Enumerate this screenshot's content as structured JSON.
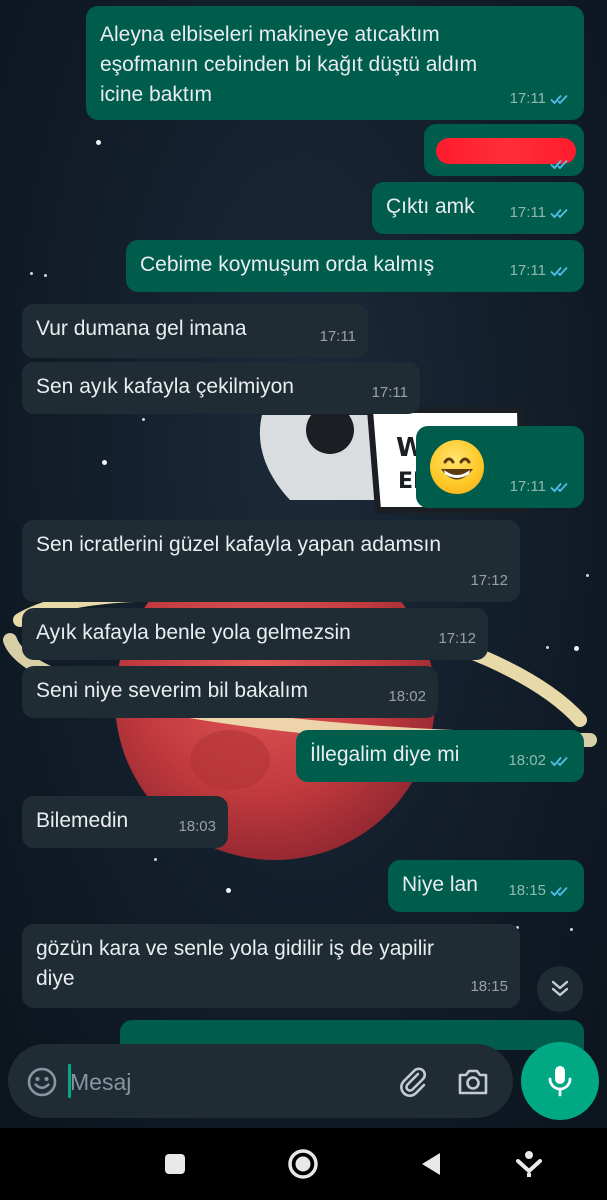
{
  "messages": [
    {
      "dir": "out",
      "text": "Aleyna elbiseleri makineye atıcaktım\neşofmanın cebinden bi kağıt düştü aldım\nicine baktım",
      "time": "17:11",
      "status": "read"
    },
    {
      "dir": "out",
      "text": "",
      "time": "",
      "status": "read",
      "redacted": true
    },
    {
      "dir": "out",
      "text": "Çıktı amk",
      "time": "17:11",
      "status": "read"
    },
    {
      "dir": "out",
      "text": "Cebime koymuşum orda kalmış",
      "time": "17:11",
      "status": "read"
    },
    {
      "dir": "in",
      "text": "Vur dumana gel imana",
      "time": "17:11"
    },
    {
      "dir": "in",
      "text": "Sen ayık kafayla çekilmiyon",
      "time": "17:11"
    },
    {
      "dir": "out",
      "text": "😁",
      "time": "17:11",
      "status": "read",
      "emoji": "grinning-face"
    },
    {
      "dir": "in",
      "text": "Sen icratlerini güzel kafayla yapan adamsın",
      "time": "17:12"
    },
    {
      "dir": "in",
      "text": "Ayık kafayla benle yola gelmezsin",
      "time": "17:12"
    },
    {
      "dir": "in",
      "text": "Seni niye severim bil bakalım",
      "time": "18:02"
    },
    {
      "dir": "out",
      "text": "İllegalim diye mi",
      "time": "18:02",
      "status": "read"
    },
    {
      "dir": "in",
      "text": "Bilemedin",
      "time": "18:03"
    },
    {
      "dir": "out",
      "text": "Niye lan",
      "time": "18:15",
      "status": "read"
    },
    {
      "dir": "in",
      "text": "gözün kara ve senle yola gidilir iş de yapilir\ndiye",
      "time": "18:15"
    }
  ],
  "composer": {
    "placeholder": "Mesaj",
    "value": ""
  },
  "icons": {
    "emoji": "emoji-icon",
    "attach": "paperclip-icon",
    "camera": "camera-icon",
    "mic": "microphone-icon",
    "scroll": "double-chevron-down-icon",
    "nav": [
      "recent-apps-icon",
      "home-icon",
      "back-icon",
      "assistant-icon"
    ]
  },
  "colors": {
    "outgoing_bubble": "#005c4b",
    "incoming_bubble": "#1f2c34",
    "read_ticks": "#53bdeb",
    "accent": "#00a884",
    "redaction": "#ff1b2d"
  }
}
